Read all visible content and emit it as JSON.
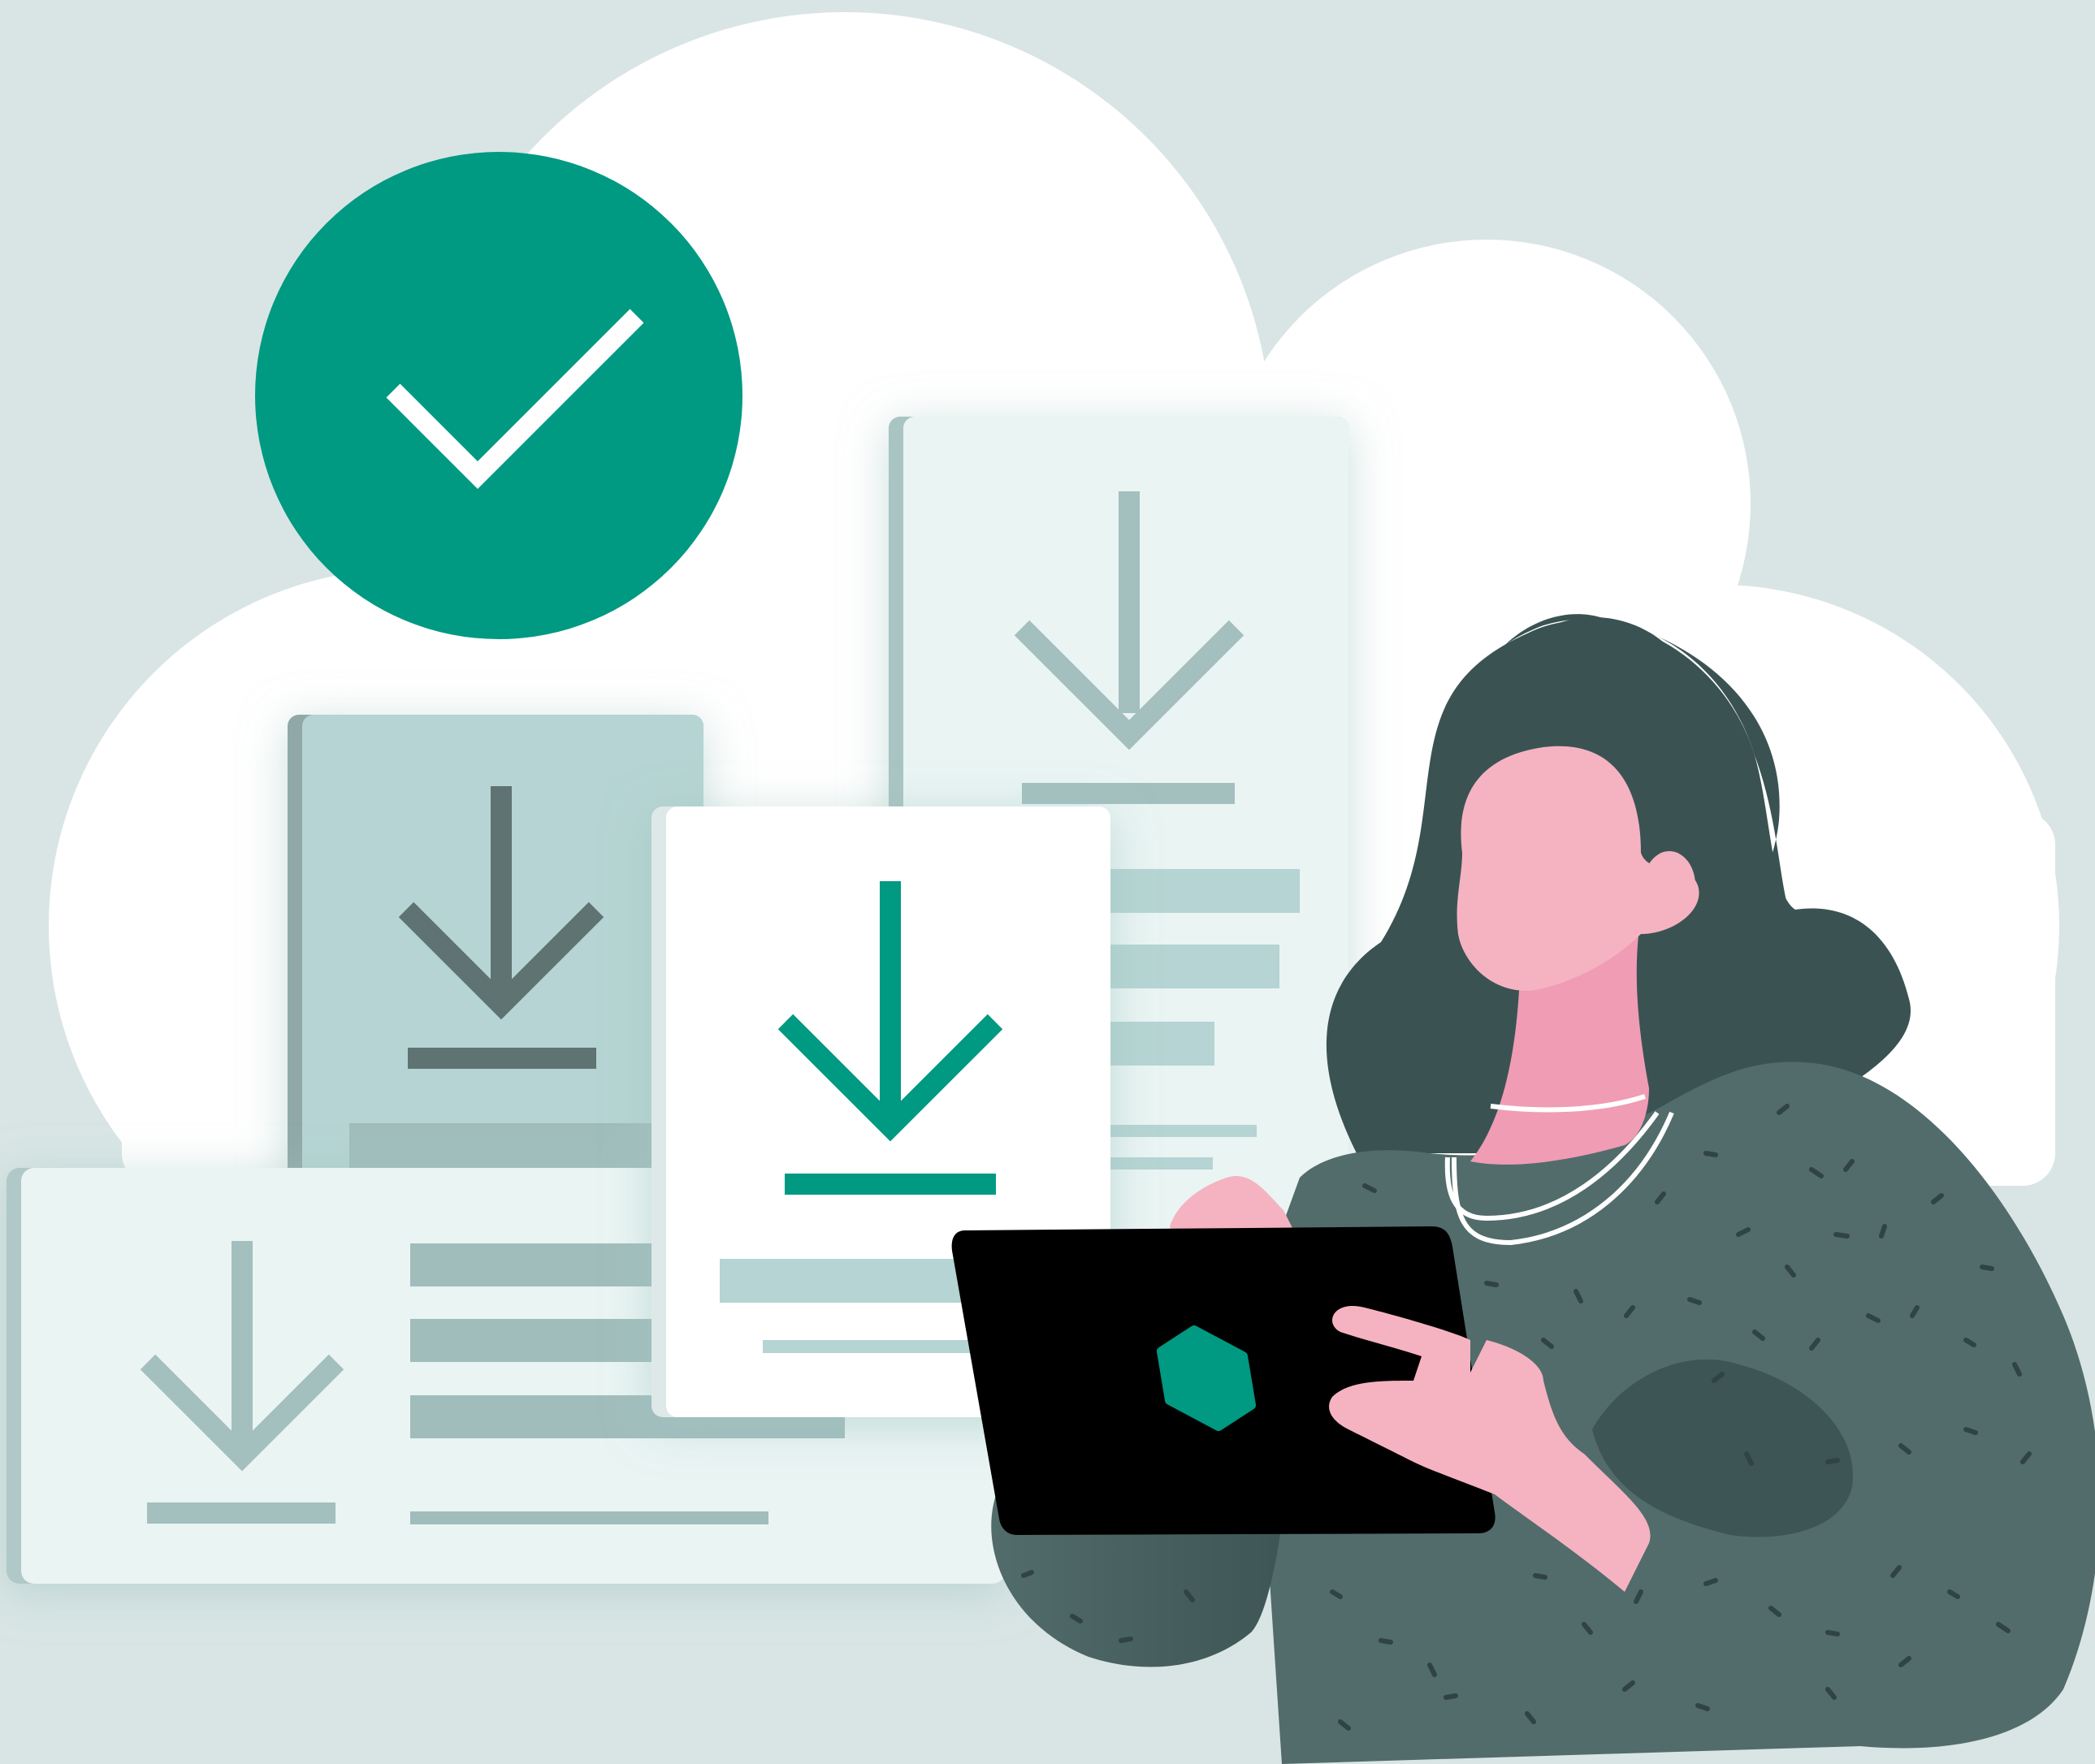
{
  "illustration": {
    "theme": "cloud-download-complete",
    "colors": {
      "background": "#d9e5e5",
      "cloud": "#ffffff",
      "accent_green": "#009982",
      "check_mark": "#ffffff",
      "card_light": "#e9f4f3",
      "card_mid": "#b5d4d3",
      "card_white": "#ffffff",
      "gray_bar": "#a0bdbc",
      "gray_arrow": "#a3bfbe",
      "dark_arrow": "#5e7372",
      "hair": "#3a5352",
      "sweater": "#526c6b",
      "skin": "#f5b3c1",
      "neck": "#f09cb5",
      "tablet": "#000000"
    },
    "icons": [
      "check-circle-icon",
      "download-icon",
      "hexagon-logo-icon"
    ],
    "elements": {
      "badge": "check-circle-icon",
      "documents": [
        "download-card-back-right",
        "download-card-back-left",
        "download-card-wide",
        "download-card-front"
      ],
      "person": "person-with-tablet"
    }
  }
}
